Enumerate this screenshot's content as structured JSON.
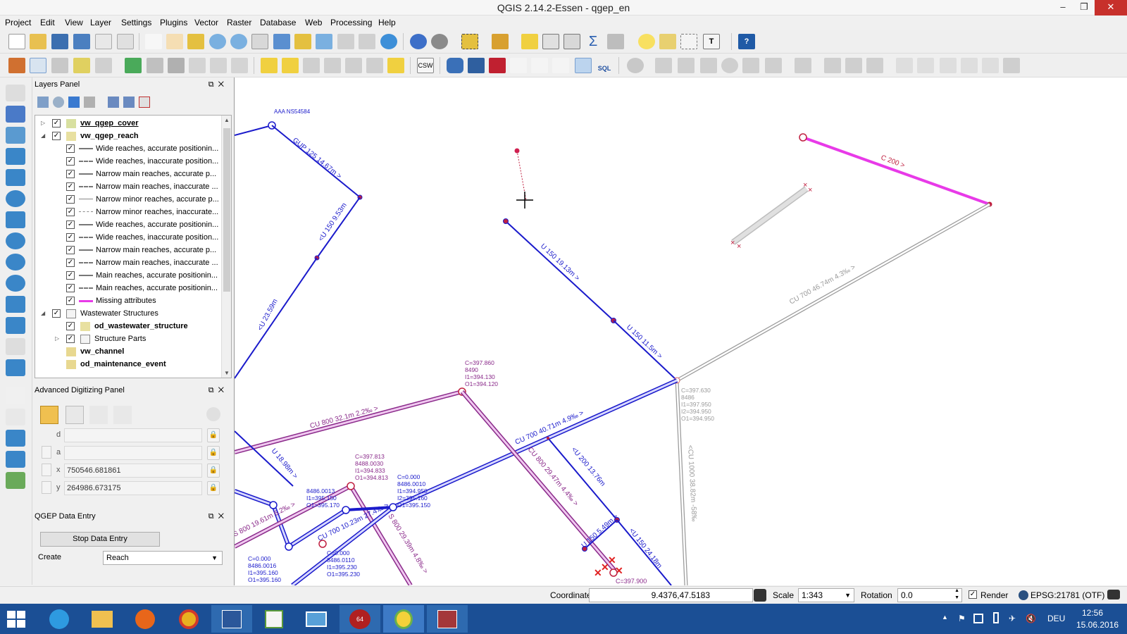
{
  "window": {
    "title": "QGIS 2.14.2-Essen - qgep_en"
  },
  "menu": [
    "Project",
    "Edit",
    "View",
    "Layer",
    "Settings",
    "Plugins",
    "Vector",
    "Raster",
    "Database",
    "Web",
    "Processing",
    "Help"
  ],
  "toolbar": {
    "csw_label": "CSW",
    "sql_label": "SQL"
  },
  "layers_panel": {
    "title": "Layers Panel",
    "items": [
      {
        "label": "vw_qgep_cover",
        "bold": true,
        "underline": true
      },
      {
        "label": "vw_qgep_reach",
        "bold": true
      },
      {
        "label": "Wide reaches, accurate positionin..."
      },
      {
        "label": "Wide reaches, inaccurate position..."
      },
      {
        "label": "Narrow main reaches, accurate p..."
      },
      {
        "label": "Narrow main reaches, inaccurate ..."
      },
      {
        "label": "Narrow minor reaches, accurate p..."
      },
      {
        "label": "Narrow minor reaches, inaccurate..."
      },
      {
        "label": "Wide reaches, accurate positionin..."
      },
      {
        "label": "Wide reaches, inaccurate position..."
      },
      {
        "label": "Narrow main reaches, accurate p..."
      },
      {
        "label": "Narrow main reaches, inaccurate ..."
      },
      {
        "label": "Main reaches, accurate positionin..."
      },
      {
        "label": "Main reaches, accurate positionin..."
      },
      {
        "label": "Missing attributes"
      },
      {
        "label": "Wastewater Structures"
      },
      {
        "label": "od_wastewater_structure",
        "bold": true
      },
      {
        "label": "Structure Parts"
      },
      {
        "label": "vw_channel",
        "bold": true
      },
      {
        "label": "od_maintenance_event",
        "bold": true
      }
    ]
  },
  "adv_digitizing": {
    "title": "Advanced Digitizing Panel",
    "d_label": "d",
    "a_label": "a",
    "x_label": "x",
    "x_value": "750546.681861",
    "y_label": "y",
    "y_value": "264986.673175"
  },
  "qgep": {
    "title": "QGEP Data Entry",
    "stop_button": "Stop Data Entry",
    "create_label": "Create",
    "create_value": "Reach"
  },
  "map": {
    "labels": {
      "aaa": "AAA NS54584",
      "gup": "GUP 125 14.67m >",
      "u150_953": "<U 150 9.53m",
      "u_2359": "<U 23.59m",
      "u150_1913": "U 150 19.13m >",
      "u150_115": "U 150 11.5m >",
      "c200": "C 200 >",
      "cu700_4674": "CU 700 46.74m 4.3‰ >",
      "cu800_321": "CU 800 32.1m 2.2‰ >",
      "cu700_4071": "CU 700 40.71m 4.9‰ >",
      "cu800_2947": "CU 800 29.47m 4.4‰ >",
      "u200_1376": "<U 200 13.76m",
      "u_1898": "U 18.98m >",
      "s800_1961": "S 800 19.61m 6.2‰ >",
      "cu700_1023": "CU 700 10.23m 27.4‰ >",
      "s800_2939": "S 800 29.39m 4.8‰ >",
      "u150_549": "U 150 5.49m >",
      "u150_2418": "<U 150 24.18m",
      "cu1000": "<CU 1000 38.82m -58‰",
      "c397900": "C=397.900"
    },
    "annotations": [
      {
        "lines": [
          "C=397.860",
          "8490",
          "I1=394.130",
          "O1=394.120"
        ]
      },
      {
        "lines": [
          "C=397.630",
          "8486",
          "I1=397.950",
          "I2=394.950",
          "O1=394.950"
        ]
      },
      {
        "lines": [
          "C=397.813",
          "8488.0030",
          "I1=394.833",
          "O1=394.813"
        ]
      },
      {
        "lines": [
          "C=0.000",
          "8486.0010",
          "I1=394.950",
          "I2=395.160",
          "O1=395.150"
        ]
      },
      {
        "lines": [
          "8486.0013",
          "I1=395.150",
          "O1=395.170"
        ]
      },
      {
        "lines": [
          "C=0.000",
          "8486.0016",
          "I1=395.160",
          "O1=395.160"
        ]
      },
      {
        "lines": [
          "C=0.000",
          "8486.0110",
          "I1=395.230",
          "O1=395.230"
        ]
      }
    ]
  },
  "statusbar": {
    "coordinate_label": "Coordinate",
    "coordinate_value": "9.4376,47.5183",
    "scale_label": "Scale",
    "scale_value": "1:343",
    "rotation_label": "Rotation",
    "rotation_value": "0.0",
    "render_label": "Render",
    "crs": "EPSG:21781 (OTF)"
  },
  "taskbar": {
    "lang": "DEU",
    "time": "12:56",
    "date": "15.06.2016",
    "badge": "64"
  },
  "colors": {
    "reach_blue": "#1a1acb",
    "missing_magenta": "#e83ae8",
    "channel_purple": "#8a2a8a",
    "gray_line": "#9a9a9a",
    "node_red": "#c02040",
    "taskbar": "#1b4f95"
  }
}
